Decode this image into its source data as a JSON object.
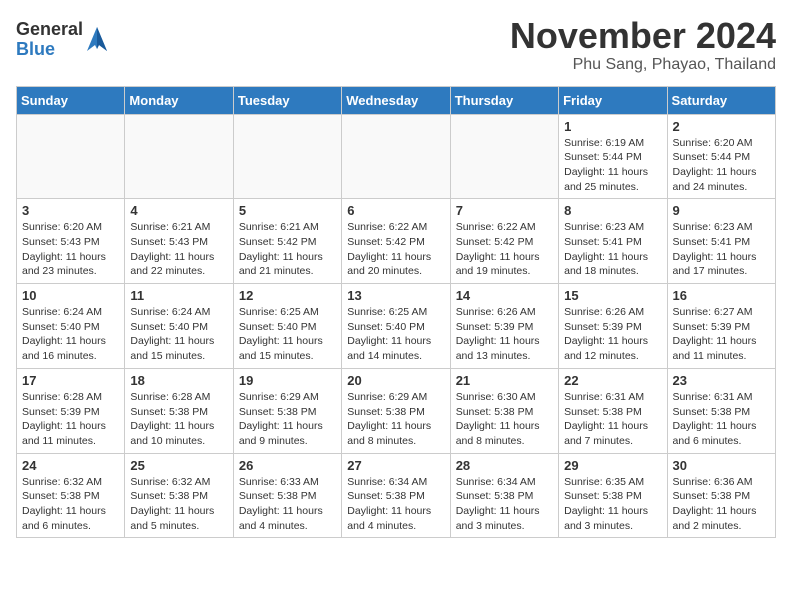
{
  "logo": {
    "general": "General",
    "blue": "Blue"
  },
  "header": {
    "month": "November 2024",
    "location": "Phu Sang, Phayao, Thailand"
  },
  "weekdays": [
    "Sunday",
    "Monday",
    "Tuesday",
    "Wednesday",
    "Thursday",
    "Friday",
    "Saturday"
  ],
  "weeks": [
    [
      {
        "day": "",
        "info": ""
      },
      {
        "day": "",
        "info": ""
      },
      {
        "day": "",
        "info": ""
      },
      {
        "day": "",
        "info": ""
      },
      {
        "day": "",
        "info": ""
      },
      {
        "day": "1",
        "info": "Sunrise: 6:19 AM\nSunset: 5:44 PM\nDaylight: 11 hours\nand 25 minutes."
      },
      {
        "day": "2",
        "info": "Sunrise: 6:20 AM\nSunset: 5:44 PM\nDaylight: 11 hours\nand 24 minutes."
      }
    ],
    [
      {
        "day": "3",
        "info": "Sunrise: 6:20 AM\nSunset: 5:43 PM\nDaylight: 11 hours\nand 23 minutes."
      },
      {
        "day": "4",
        "info": "Sunrise: 6:21 AM\nSunset: 5:43 PM\nDaylight: 11 hours\nand 22 minutes."
      },
      {
        "day": "5",
        "info": "Sunrise: 6:21 AM\nSunset: 5:42 PM\nDaylight: 11 hours\nand 21 minutes."
      },
      {
        "day": "6",
        "info": "Sunrise: 6:22 AM\nSunset: 5:42 PM\nDaylight: 11 hours\nand 20 minutes."
      },
      {
        "day": "7",
        "info": "Sunrise: 6:22 AM\nSunset: 5:42 PM\nDaylight: 11 hours\nand 19 minutes."
      },
      {
        "day": "8",
        "info": "Sunrise: 6:23 AM\nSunset: 5:41 PM\nDaylight: 11 hours\nand 18 minutes."
      },
      {
        "day": "9",
        "info": "Sunrise: 6:23 AM\nSunset: 5:41 PM\nDaylight: 11 hours\nand 17 minutes."
      }
    ],
    [
      {
        "day": "10",
        "info": "Sunrise: 6:24 AM\nSunset: 5:40 PM\nDaylight: 11 hours\nand 16 minutes."
      },
      {
        "day": "11",
        "info": "Sunrise: 6:24 AM\nSunset: 5:40 PM\nDaylight: 11 hours\nand 15 minutes."
      },
      {
        "day": "12",
        "info": "Sunrise: 6:25 AM\nSunset: 5:40 PM\nDaylight: 11 hours\nand 15 minutes."
      },
      {
        "day": "13",
        "info": "Sunrise: 6:25 AM\nSunset: 5:40 PM\nDaylight: 11 hours\nand 14 minutes."
      },
      {
        "day": "14",
        "info": "Sunrise: 6:26 AM\nSunset: 5:39 PM\nDaylight: 11 hours\nand 13 minutes."
      },
      {
        "day": "15",
        "info": "Sunrise: 6:26 AM\nSunset: 5:39 PM\nDaylight: 11 hours\nand 12 minutes."
      },
      {
        "day": "16",
        "info": "Sunrise: 6:27 AM\nSunset: 5:39 PM\nDaylight: 11 hours\nand 11 minutes."
      }
    ],
    [
      {
        "day": "17",
        "info": "Sunrise: 6:28 AM\nSunset: 5:39 PM\nDaylight: 11 hours\nand 11 minutes."
      },
      {
        "day": "18",
        "info": "Sunrise: 6:28 AM\nSunset: 5:38 PM\nDaylight: 11 hours\nand 10 minutes."
      },
      {
        "day": "19",
        "info": "Sunrise: 6:29 AM\nSunset: 5:38 PM\nDaylight: 11 hours\nand 9 minutes."
      },
      {
        "day": "20",
        "info": "Sunrise: 6:29 AM\nSunset: 5:38 PM\nDaylight: 11 hours\nand 8 minutes."
      },
      {
        "day": "21",
        "info": "Sunrise: 6:30 AM\nSunset: 5:38 PM\nDaylight: 11 hours\nand 8 minutes."
      },
      {
        "day": "22",
        "info": "Sunrise: 6:31 AM\nSunset: 5:38 PM\nDaylight: 11 hours\nand 7 minutes."
      },
      {
        "day": "23",
        "info": "Sunrise: 6:31 AM\nSunset: 5:38 PM\nDaylight: 11 hours\nand 6 minutes."
      }
    ],
    [
      {
        "day": "24",
        "info": "Sunrise: 6:32 AM\nSunset: 5:38 PM\nDaylight: 11 hours\nand 6 minutes."
      },
      {
        "day": "25",
        "info": "Sunrise: 6:32 AM\nSunset: 5:38 PM\nDaylight: 11 hours\nand 5 minutes."
      },
      {
        "day": "26",
        "info": "Sunrise: 6:33 AM\nSunset: 5:38 PM\nDaylight: 11 hours\nand 4 minutes."
      },
      {
        "day": "27",
        "info": "Sunrise: 6:34 AM\nSunset: 5:38 PM\nDaylight: 11 hours\nand 4 minutes."
      },
      {
        "day": "28",
        "info": "Sunrise: 6:34 AM\nSunset: 5:38 PM\nDaylight: 11 hours\nand 3 minutes."
      },
      {
        "day": "29",
        "info": "Sunrise: 6:35 AM\nSunset: 5:38 PM\nDaylight: 11 hours\nand 3 minutes."
      },
      {
        "day": "30",
        "info": "Sunrise: 6:36 AM\nSunset: 5:38 PM\nDaylight: 11 hours\nand 2 minutes."
      }
    ]
  ]
}
